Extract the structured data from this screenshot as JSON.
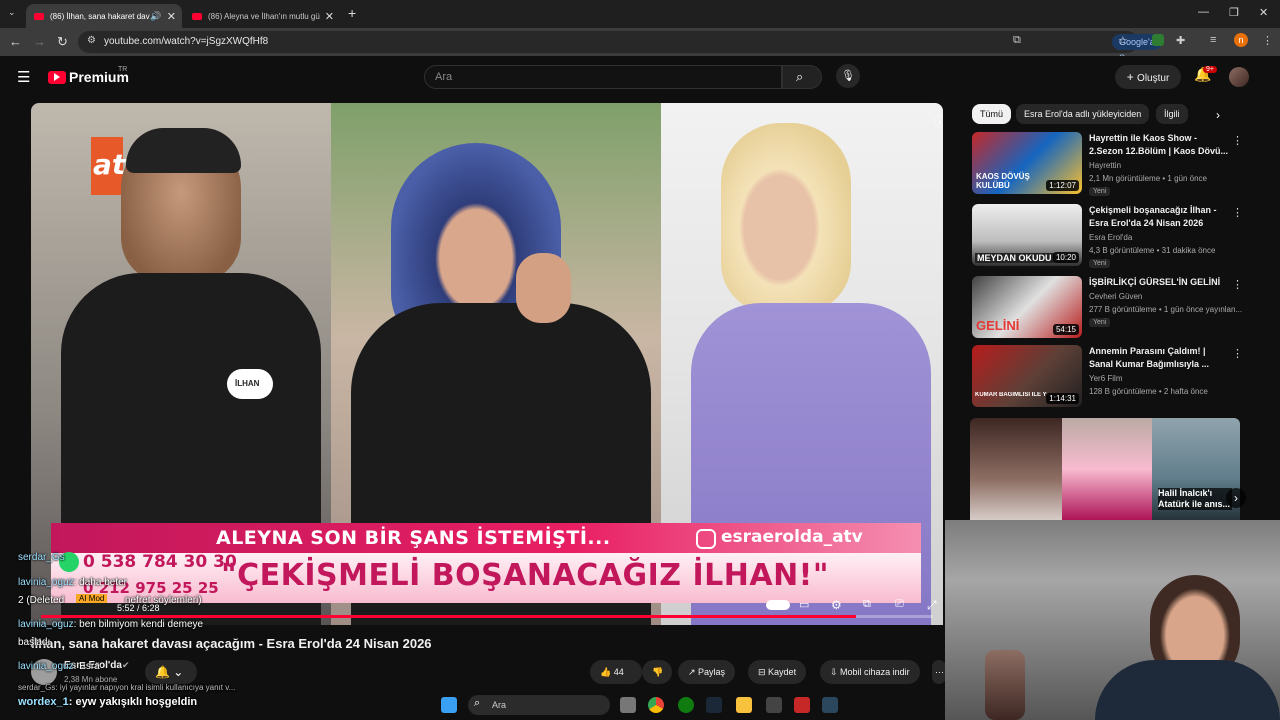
{
  "browser": {
    "tabs": [
      {
        "title": "(86) İlhan, sana hakaret dav",
        "active": true
      },
      {
        "title": "(86) Aleyna ve İlhan'ın mutlu gü",
        "active": false
      }
    ],
    "url": "youtube.com/watch?v=jSgzXWQfHf8",
    "google_sor": "Google'a Sor",
    "profile_initial": "n"
  },
  "yt": {
    "logo_text": "Premium",
    "region": "TR",
    "search_placeholder": "Ara",
    "create_label": "Oluştur",
    "notif_count": "9+"
  },
  "video": {
    "channel_logo": "atv",
    "caption_line1": "ALEYNA SON BİR ŞANS İSTEMİŞTİ...",
    "caption_handle": "esraerolda_atv",
    "caption_line2": "\"ÇEKİŞMELİ BOŞANACAĞIZ İLHAN!\"",
    "phone1": "0 538 784 30 30",
    "phone2": "0 212 975 25 25",
    "time": "5:52 / 6:28",
    "badge_ilhan": "İLHAN",
    "title": "İlhan, sana hakaret davası açacağım - Esra Erol'da 24 Nisan 2026",
    "channel_name": "Esra Erol'da",
    "subs": "2,38 Mn abone",
    "likes": "44",
    "share": "Paylaş",
    "save": "Kaydet",
    "download": "Mobil cihaza indir"
  },
  "sidebar": {
    "chips": [
      "Tümü",
      "Esra Erol'da adlı yükleyiciden",
      "İlgili"
    ],
    "recs": [
      {
        "title": "Hayrettin ile Kaos Show - 2.Sezon 12.Bölüm | Kaos Dövü...",
        "channel": "Hayrettin",
        "meta": "2,1 Mn görüntüleme • 1 gün önce",
        "badge": "Yeni",
        "duration": "1:12:07",
        "thumb_text": "KAOS DÖVÜŞ KULÜBÜ"
      },
      {
        "title": "Çekişmeli boşanacağız İlhan - Esra Erol'da 24 Nisan 2026",
        "channel": "Esra Erol'da",
        "meta": "4,3 B görüntüleme • 31 dakika önce",
        "badge": "Yeni",
        "duration": "10:20",
        "thumb_text": "MEYDAN OKUDU"
      },
      {
        "title": "İŞBİRLİKÇİ GÜRSEL'İN GELİNİ",
        "channel": "Cevheri Güven",
        "meta": "277 B görüntüleme • 1 gün önce yayınlan...",
        "badge": "Yeni",
        "duration": "54:15",
        "thumb_text": "GELİNİ"
      },
      {
        "title": "Annemin Parasını Çaldım! | Sanal Kumar Bağımlısıyla ...",
        "channel": "Yer6 Film",
        "meta": "128 B görüntüleme • 2 hafta önce",
        "badge": "",
        "duration": "1:14:31",
        "thumb_text": "KUMAR BAĞIMLISI İLE YÜZLEŞTİM"
      }
    ],
    "shelf_caption": "Halil İnalcık'ı Atatürk ile anıs..."
  },
  "chat": [
    {
      "user": "serdar_Gs",
      "text": ""
    },
    {
      "user": "lavinia_oguz",
      "text": "daha beter"
    },
    {
      "user": "2 (Deleted",
      "text": "nefret söylemleri)"
    },
    {
      "user": "lavinia_oguz",
      "text": "ben bilmiyom kendi demeye"
    },
    {
      "user": "",
      "text": "başladı"
    },
    {
      "user": "lavinia_oguz",
      "text": "Esra"
    },
    {
      "user": "serdar_Gs",
      "text": "iyi yayınlar napıyon kral isimli kullanıcıya yanıt v..."
    },
    {
      "user": "wordex_1",
      "text": "eyw yakışıklı hoşgeldin"
    }
  ],
  "chat_ai_mod": "AI Mod",
  "taskbar": {
    "search": "Ara"
  }
}
